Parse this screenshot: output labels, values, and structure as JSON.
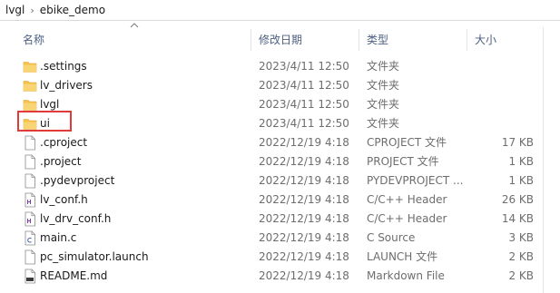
{
  "breadcrumb": {
    "items": [
      "lvgl",
      "ebike_demo"
    ],
    "separator": "›"
  },
  "columns": {
    "name": "名称",
    "date": "修改日期",
    "type": "类型",
    "size": "大小"
  },
  "files": [
    {
      "name": ".settings",
      "date": "2023/4/11 12:50",
      "type": "文件夹",
      "size": "",
      "icon": "folder-icon"
    },
    {
      "name": "lv_drivers",
      "date": "2023/4/11 12:50",
      "type": "文件夹",
      "size": "",
      "icon": "folder-icon"
    },
    {
      "name": "lvgl",
      "date": "2023/4/11 12:50",
      "type": "文件夹",
      "size": "",
      "icon": "folder-icon"
    },
    {
      "name": "ui",
      "date": "2023/4/11 12:50",
      "type": "文件夹",
      "size": "",
      "icon": "folder-icon"
    },
    {
      "name": ".cproject",
      "date": "2022/12/19 4:18",
      "type": "CPROJECT 文件",
      "size": "17 KB",
      "icon": "file-icon"
    },
    {
      "name": ".project",
      "date": "2022/12/19 4:18",
      "type": "PROJECT 文件",
      "size": "1 KB",
      "icon": "file-icon"
    },
    {
      "name": ".pydevproject",
      "date": "2022/12/19 4:18",
      "type": "PYDEVPROJECT ...",
      "size": "1 KB",
      "icon": "file-icon"
    },
    {
      "name": "lv_conf.h",
      "date": "2022/12/19 4:18",
      "type": "C/C++ Header",
      "size": "26 KB",
      "icon": "header-file-icon"
    },
    {
      "name": "lv_drv_conf.h",
      "date": "2022/12/19 4:18",
      "type": "C/C++ Header",
      "size": "14 KB",
      "icon": "header-file-icon"
    },
    {
      "name": "main.c",
      "date": "2022/12/19 4:18",
      "type": "C Source",
      "size": "3 KB",
      "icon": "c-source-file-icon"
    },
    {
      "name": "pc_simulator.launch",
      "date": "2022/12/19 4:18",
      "type": "LAUNCH 文件",
      "size": "2 KB",
      "icon": "file-icon"
    },
    {
      "name": "README.md",
      "date": "2022/12/19 4:18",
      "type": "Markdown File",
      "size": "2 KB",
      "icon": "markdown-file-icon"
    }
  ],
  "colors": {
    "folder": "#f5c34d",
    "highlight": "#e03a3a",
    "header_text": "#4d6082"
  }
}
